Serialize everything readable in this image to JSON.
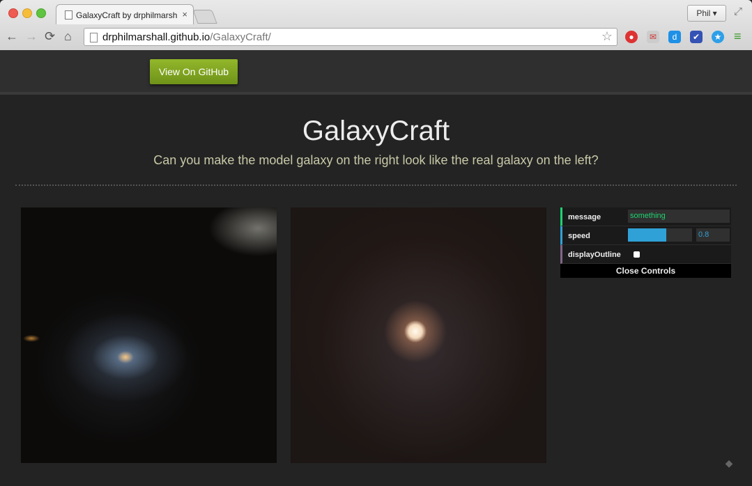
{
  "browser": {
    "tab_title": "GalaxyCraft by drphilmarsh",
    "tab_close": "×",
    "profile_label": "Phil ▾",
    "url_host": "drphilmarshall.github.io",
    "url_path": "/GalaxyCraft/",
    "back": "←",
    "forward": "→",
    "reload": "⟳",
    "home": "⌂",
    "star": "☆",
    "menu": "≡"
  },
  "header": {
    "github_button": "View On GitHub"
  },
  "main": {
    "title": "GalaxyCraft",
    "subtitle": "Can you make the model galaxy on the right look like the real galaxy on the left?"
  },
  "controls": {
    "message_label": "message",
    "message_value": "something",
    "speed_label": "speed",
    "speed_value": "0.8",
    "display_outline_label": "displayOutline",
    "close_label": "Close Controls"
  },
  "colors": {
    "accent_green": "#1ed36f",
    "accent_blue": "#2fa1d6",
    "accent_purple": "#806787",
    "github_button": "#7fa21f"
  }
}
